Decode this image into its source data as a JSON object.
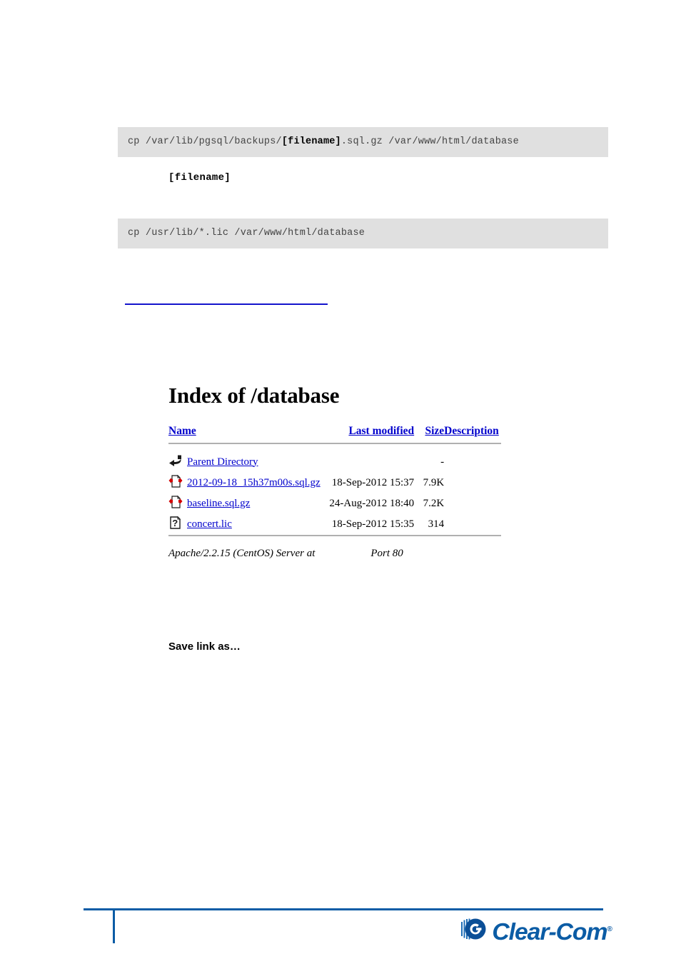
{
  "code_blocks": [
    {
      "id": "code-block-1",
      "prefix": "cp /var/lib/pgsql/backups/",
      "bold": "[filename]",
      "suffix": ".sql.gz /var/www/html/database"
    },
    {
      "id": "code-block-2",
      "prefix": "cp /usr/lib/*.lic /var/www/html/database",
      "bold": "",
      "suffix": ""
    }
  ],
  "mono_note": "[filename]",
  "blank_link": {
    "text": ""
  },
  "apache_index": {
    "title": "Index of /database",
    "columns": {
      "name": "Name",
      "last_modified": "Last modified",
      "size": "Size",
      "description": "Description"
    },
    "rows": [
      {
        "icon": "back-arrow-icon",
        "name": "Parent Directory",
        "last_modified": "",
        "size": "-",
        "description": ""
      },
      {
        "icon": "compressed-file-icon",
        "name": "2012-09-18_15h37m00s.sql.gz",
        "last_modified": "18-Sep-2012 15:37",
        "size": "7.9K",
        "description": ""
      },
      {
        "icon": "compressed-file-icon",
        "name": "baseline.sql.gz",
        "last_modified": "24-Aug-2012 18:40",
        "size": "7.2K",
        "description": ""
      },
      {
        "icon": "unknown-file-icon",
        "name": "concert.lic",
        "last_modified": "18-Sep-2012 15:35",
        "size": "314",
        "description": ""
      }
    ],
    "footer_prefix": "Apache/2.2.15 (CentOS) Server at",
    "footer_suffix": "Port 80"
  },
  "save_link_as": "Save link as…",
  "brand": {
    "name": "Clear-Com",
    "registered_mark": "®",
    "color": "#0b5ca5"
  }
}
